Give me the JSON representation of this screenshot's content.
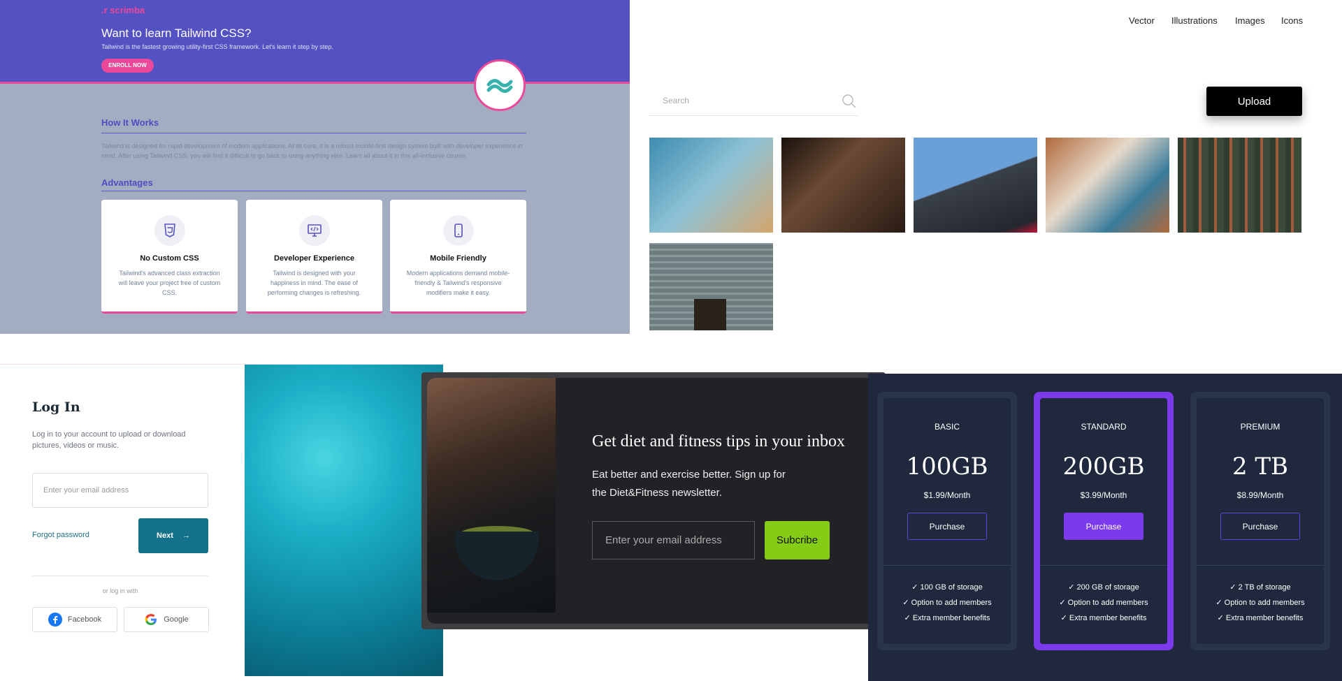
{
  "scrimba": {
    "logo": ".r scrimba",
    "title": "Want to learn Tailwind CSS?",
    "subtitle": "Tailwind is the fastest growing utility-first CSS framework. Let's learn it step by step.",
    "enroll": "ENROLL NOW",
    "how_title": "How It Works",
    "how_body": "Tailwind is designed for rapid development of modern applications. At its core, it is a robust mobile-first design system built with developer experience in mind. After using Tailwind CSS, you will find it difficult to go back to using anything else. Learn all about it in this all-inclusive course.",
    "adv_title": "Advantages",
    "cards": [
      {
        "icon": "css3-icon",
        "title": "No Custom CSS",
        "desc": "Tailwind's advanced class extraction will leave your project free of custom CSS."
      },
      {
        "icon": "monitor-code-icon",
        "title": "Developer Experience",
        "desc": "Tailwind is designed with your happiness in mind. The ease of performing changes is refreshing."
      },
      {
        "icon": "phone-icon",
        "title": "Mobile Friendly",
        "desc": "Modern applications demand mobile-friendly & Tailwind's responsive modifiers make it easy."
      }
    ]
  },
  "gallery": {
    "nav": [
      "Vector",
      "Illustrations",
      "Images",
      "Icons"
    ],
    "search_placeholder": "Search",
    "upload": "Upload",
    "thumb_colors": [
      "#3f8fb0",
      "#2a1b14",
      "#6aa0d8",
      "#b06a3c",
      "#3c4a3a",
      "#6e7d7f"
    ]
  },
  "login": {
    "title": "Log In",
    "subtitle": "Log in to your account to upload or download pictures, videos or music.",
    "email_placeholder": "Enter your email address",
    "forgot": "Forgot password",
    "next": "Next",
    "or": "or log in with",
    "facebook": "Facebook",
    "google": "Google"
  },
  "newsletter": {
    "title": "Get diet and fitness tips in your inbox",
    "desc": "Eat better and exercise better. Sign up for the Diet&Fitness newsletter.",
    "email_placeholder": "Enter your email address",
    "subscribe": "Subcribe"
  },
  "pricing": {
    "plans": [
      {
        "name": "BASIC",
        "amount": "100GB",
        "price": "$1.99/Month",
        "button": "Purchase",
        "features": [
          "100 GB of storage",
          "Option to add members",
          "Extra member benefits"
        ]
      },
      {
        "name": "STANDARD",
        "amount": "200GB",
        "price": "$3.99/Month",
        "button": "Purchase",
        "features": [
          "200 GB of storage",
          "Option to add members",
          "Extra member benefits"
        ]
      },
      {
        "name": "PREMIUM",
        "amount": "2 TB",
        "price": "$8.99/Month",
        "button": "Purchase",
        "features": [
          "2 TB of storage",
          "Option to add members",
          "Extra member benefits"
        ]
      }
    ],
    "accent": "#7c3aed"
  }
}
